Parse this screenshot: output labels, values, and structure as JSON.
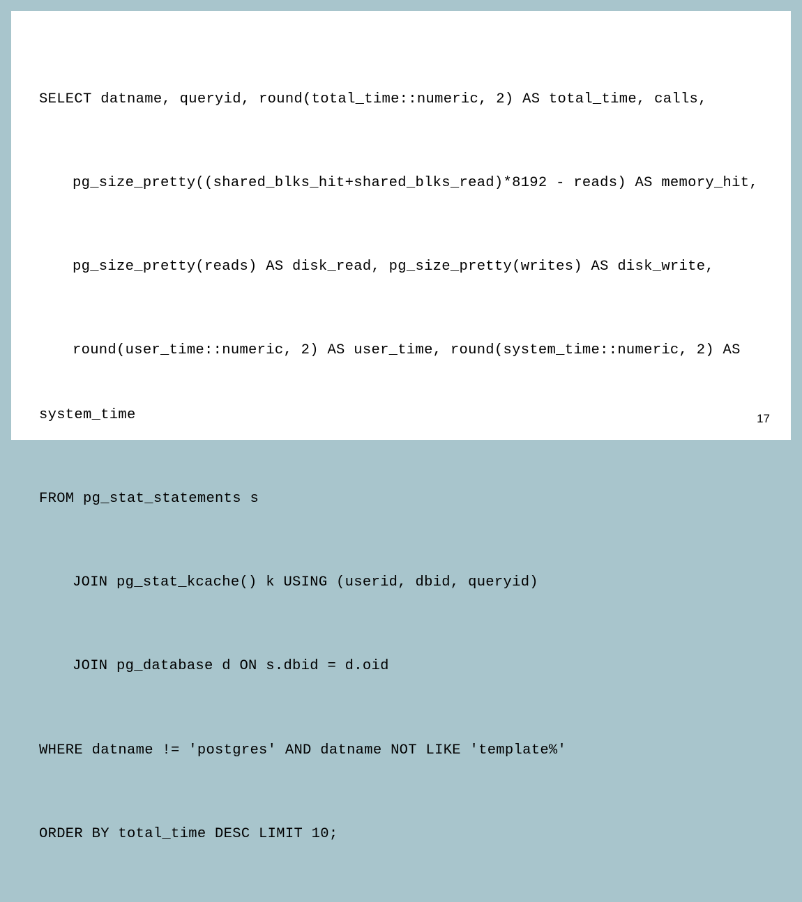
{
  "slide": {
    "page_number": "17",
    "code": {
      "line1": "SELECT datname, queryid, round(total_time::numeric, 2) AS total_time, calls,",
      "line2": "pg_size_pretty((shared_blks_hit+shared_blks_read)*8192 - reads) AS memory_hit,",
      "line3": "pg_size_pretty(reads) AS disk_read, pg_size_pretty(writes) AS disk_write,",
      "line4a": "round(user_time::numeric, 2) AS user_time, round(system_time::numeric, 2) AS",
      "line4b": "system_time",
      "line5": "FROM pg_stat_statements s",
      "line6": "JOIN pg_stat_kcache() k USING (userid, dbid, queryid)",
      "line7": "JOIN pg_database d ON s.dbid = d.oid",
      "line8": "WHERE datname != 'postgres' AND datname NOT LIKE 'template%'",
      "line9": "ORDER BY total_time DESC LIMIT 10;"
    }
  }
}
